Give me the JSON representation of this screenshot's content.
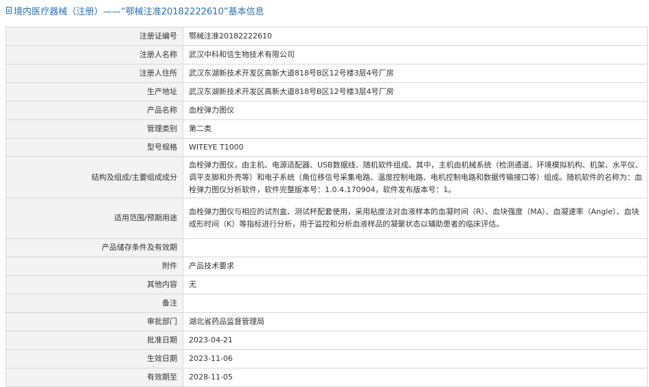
{
  "header": {
    "title": "境内医疗器械（注册）——“鄂械注准20182222610”基本信息"
  },
  "rows": [
    {
      "label": "注册证编号",
      "value": "鄂械注准20182222610"
    },
    {
      "label": "注册人名称",
      "value": "武汉中科和信生物技术有限公司"
    },
    {
      "label": "注册人住所",
      "value": "武汉东湖新技术开发区高新大道818号B区12号楼3层4号厂房"
    },
    {
      "label": "生产地址",
      "value": "武汉东湖新技术开发区高新大道818号B区12号楼3层4号厂房"
    },
    {
      "label": "产品名称",
      "value": "血栓弹力图仪"
    },
    {
      "label": "管理类别",
      "value": "第二类"
    },
    {
      "label": "型号规格",
      "value": "WITEYE T1000"
    },
    {
      "label": "结构及组成/主要组成成分",
      "value": "血栓弹力图仪，由主机、电源适配器、USB数据线、随机软件组成。其中，主机由机械系统（检测通道、环境模拟机构、机架、水平仪、调平支脚和外壳等）和电子系统（角位移信号采集电路、温度控制电路、电机控制电路和数据传输接口等）组成。随机软件的名称为：血栓弹力图仪分析软件，软件完整版本号：1.0.4.170904，软件发布版本号：1。"
    },
    {
      "label": "适用范围/预期用途",
      "value": "血栓弹力图仪与相应的试剂盒、测试杯配套使用，采用粘度法对血液样本的血凝时间（R）、血块强度（MA）、血凝速率（Angle）、血块成形时间（K）等指标进行分析，用于监控和分析血液样品的凝聚状态以辅助患者的临床评估。"
    },
    {
      "label": "产品储存条件及有效期",
      "value": ""
    },
    {
      "label": "附件",
      "value": "产品技术要求"
    },
    {
      "label": "其他内容",
      "value": "无"
    },
    {
      "label": "备注",
      "value": ""
    },
    {
      "label": "审批部门",
      "value": "湖北省药品监督管理局"
    },
    {
      "label": "批准日期",
      "value": "2023-04-21"
    },
    {
      "label": "生效日期",
      "value": "2023-11-06"
    },
    {
      "label": "有效期至",
      "value": "2028-11-05"
    }
  ]
}
